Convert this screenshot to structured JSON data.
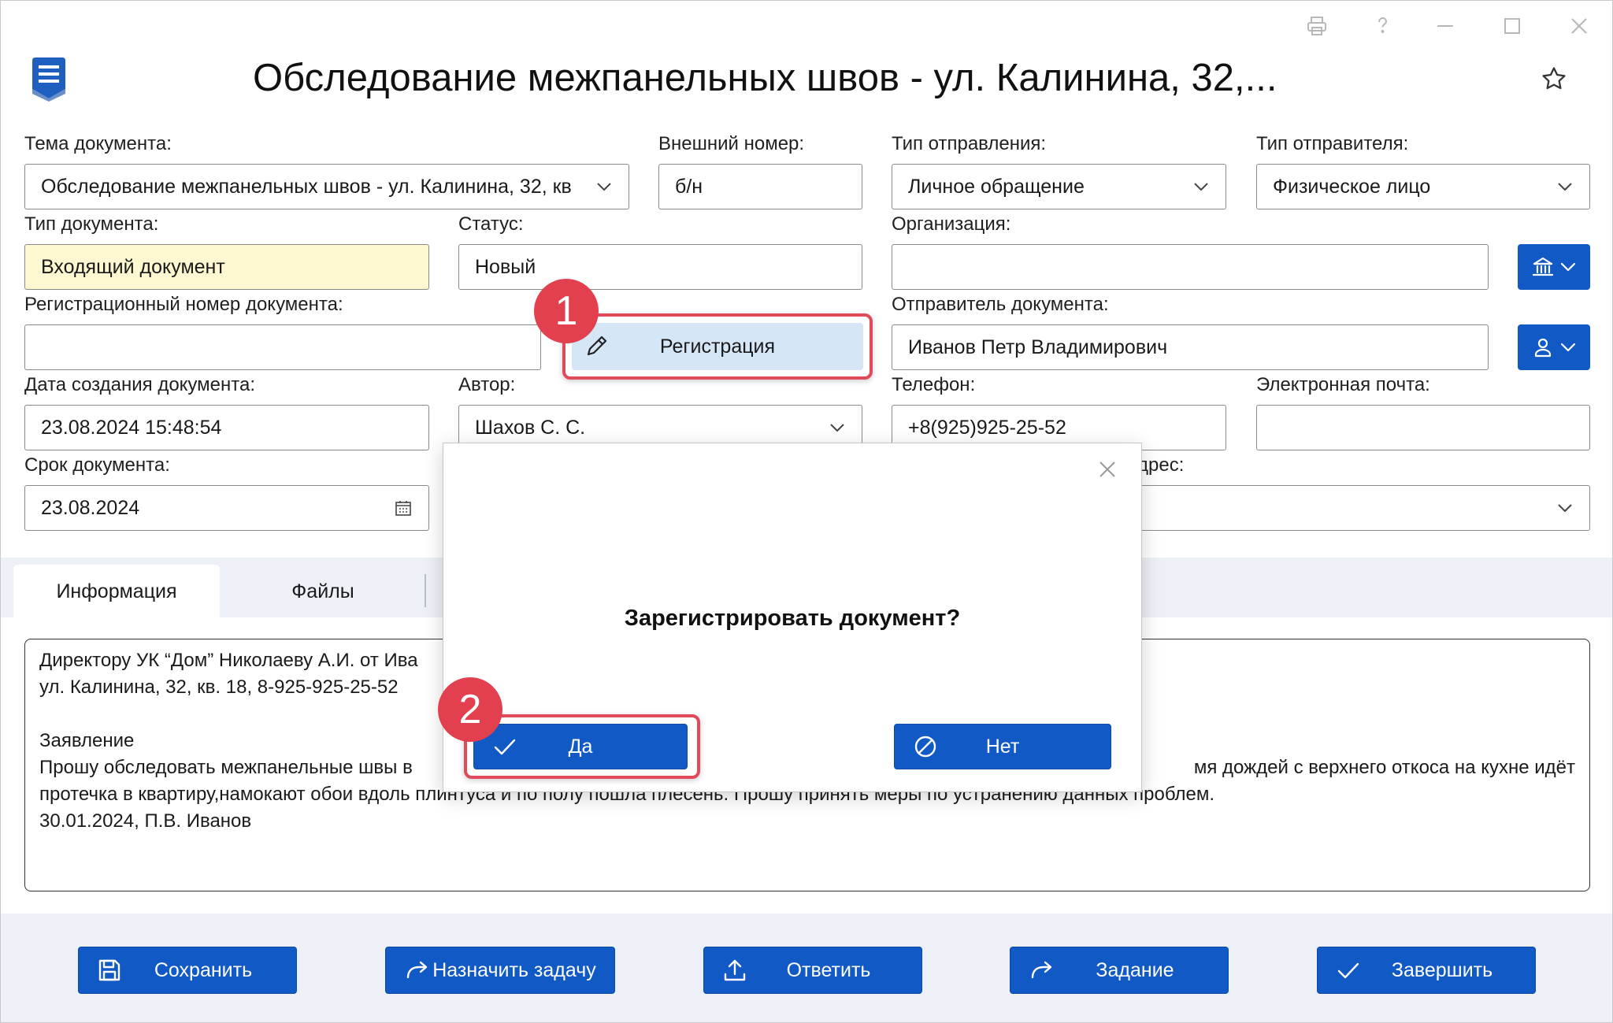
{
  "window": {
    "title": "Обследование межпанельных швов - ул. Калинина, 32,...",
    "controls": [
      "print-icon",
      "help-icon",
      "minimize-icon",
      "maximize-icon",
      "close-icon"
    ]
  },
  "form": {
    "subject_label": "Тема документа:",
    "subject_value": "Обследование межпанельных швов - ул. Калинина, 32, кв",
    "external_number_label": "Внешний номер:",
    "external_number_value": "б/н",
    "send_type_label": "Тип отправления:",
    "send_type_value": "Личное обращение",
    "sender_type_label": "Тип отправителя:",
    "sender_type_value": "Физическое лицо",
    "doc_type_label": "Тип документа:",
    "doc_type_value": "Входящий документ",
    "status_label": "Статус:",
    "status_value": "Новый",
    "org_label": "Организация:",
    "org_value": "",
    "reg_number_label": "Регистрационный номер документа:",
    "reg_number_value": "",
    "register_button": "Регистрация",
    "sender_label": "Отправитель документа:",
    "sender_value": "Иванов Петр Владимирович",
    "created_label": "Дата создания документа:",
    "created_value": "23.08.2024 15:48:54",
    "author_label": "Автор:",
    "author_value": "Шахов С. С.",
    "phone_label": "Телефон:",
    "phone_value": "+8(925)925-25-52",
    "email_label": "Электронная почта:",
    "email_value": "",
    "deadline_label": "Срок документа:",
    "deadline_value": "23.08.2024",
    "address_label_fragment": "дрес:",
    "address_value": ""
  },
  "tabs": [
    "Информация",
    "Файлы"
  ],
  "body_text": {
    "line1": "Директору УК “Дом” Николаеву А.И. от Ива",
    "line2": "ул. Калинина, 32, кв. 18, 8-925-925-25-52",
    "line3": "Заявление",
    "line4a": "Прошу обследовать межпанельные швы в",
    "line4b": "мя дождей с верхнего откоса на кухне идёт",
    "line5": "протечка в квартиру,намокают обои вдоль плинтуса и по полу пошла плесень. Прошу принять меры по устранению данных проблем.",
    "line6": "30.01.2024, П.В. Иванов"
  },
  "dialog": {
    "question": "Зарегистрировать документ?",
    "yes": "Да",
    "no": "Нет"
  },
  "actions": [
    "Сохранить",
    "Назначить задачу",
    "Ответить",
    "Задание",
    "Завершить"
  ],
  "callouts": [
    "1",
    "2"
  ],
  "colors": {
    "accent": "#1159c4",
    "callout": "#e2404f",
    "highlight_field": "#fdf8d2"
  }
}
